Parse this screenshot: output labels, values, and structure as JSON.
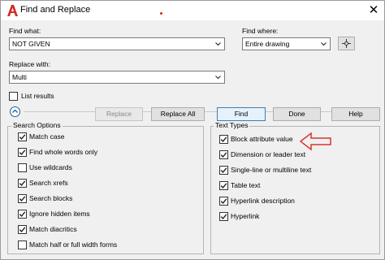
{
  "window": {
    "title": "Find and Replace",
    "close_glyph": "✕",
    "app_icon": "autocad-icon"
  },
  "find_what": {
    "label": "Find what:",
    "value": "NOT GIVEN"
  },
  "find_where": {
    "label": "Find where:",
    "value": "Entire drawing",
    "pick_icon": "select-objects-icon"
  },
  "replace_with": {
    "label": "Replace with:",
    "value": "Multi"
  },
  "list_results": {
    "label": "List results",
    "checked": false
  },
  "buttons": {
    "replace": "Replace",
    "replace_all": "Replace All",
    "find": "Find",
    "done": "Done",
    "help": "Help"
  },
  "search_options": {
    "title": "Search Options",
    "items": [
      {
        "label": "Match case",
        "checked": true
      },
      {
        "label": "Find whole words only",
        "checked": true
      },
      {
        "label": "Use wildcards",
        "checked": false
      },
      {
        "label": "Search xrefs",
        "checked": true
      },
      {
        "label": "Search blocks",
        "checked": true
      },
      {
        "label": "Ignore hidden items",
        "checked": true
      },
      {
        "label": "Match diacritics",
        "checked": true
      },
      {
        "label": "Match half or full width forms",
        "checked": false
      }
    ]
  },
  "text_types": {
    "title": "Text Types",
    "items": [
      {
        "label": "Block attribute value",
        "checked": true
      },
      {
        "label": "Dimension or leader text",
        "checked": true
      },
      {
        "label": "Single-line or multiline text",
        "checked": true
      },
      {
        "label": "Table text",
        "checked": true
      },
      {
        "label": "Hyperlink description",
        "checked": true
      },
      {
        "label": "Hyperlink",
        "checked": true
      }
    ]
  },
  "annotation": {
    "arrow_color": "#d9342b"
  }
}
